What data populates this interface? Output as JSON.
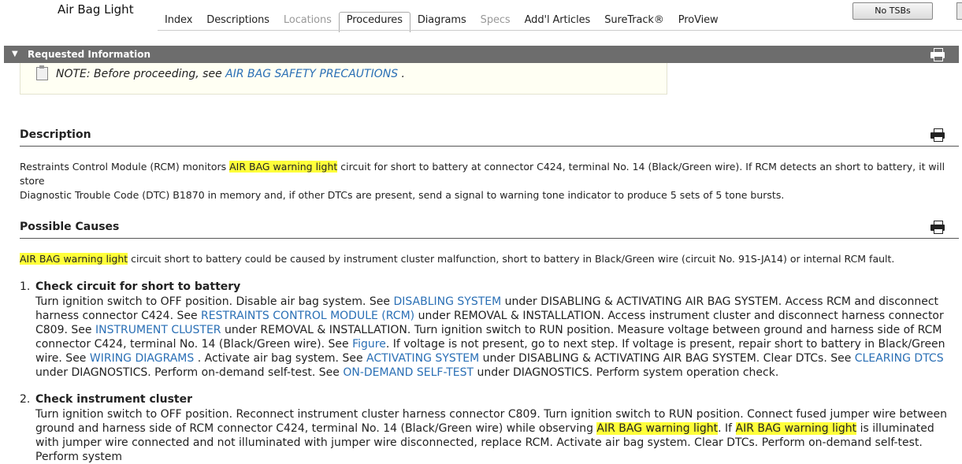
{
  "header": {
    "title": "Air Bag Light",
    "tabs": [
      {
        "label": "Index",
        "state": "normal"
      },
      {
        "label": "Descriptions",
        "state": "normal"
      },
      {
        "label": "Locations",
        "state": "disabled"
      },
      {
        "label": "Procedures",
        "state": "active"
      },
      {
        "label": "Diagrams",
        "state": "normal"
      },
      {
        "label": "Specs",
        "state": "disabled"
      },
      {
        "label": "Add'l Articles",
        "state": "normal"
      },
      {
        "label": "SureTrack®",
        "state": "normal"
      },
      {
        "label": "ProView",
        "state": "normal"
      }
    ],
    "tsb_button": "No TSBs"
  },
  "requested_info": {
    "label": "Requested Information",
    "toggle_icon": "collapse-triangle-icon",
    "print_icon": "printer-icon"
  },
  "note": {
    "prefix": "NOTE: Before proceeding, see ",
    "link": "AIR BAG SAFETY PRECAUTIONS",
    "suffix": " ."
  },
  "description": {
    "heading": "Description",
    "p1_a": "Restraints Control Module (RCM) monitors ",
    "p1_hl": "AIR BAG warning light",
    "p1_b": " circuit for short to battery at connector C424, terminal No. 14 (Black/Green wire). If RCM detects an short to battery, it will store",
    "p2": "Diagnostic Trouble Code (DTC) B1870 in memory and, if other DTCs are present, send a signal to warning tone indicator to produce 5 sets of 5 tone bursts."
  },
  "causes": {
    "heading": "Possible Causes",
    "hl": "AIR BAG warning light",
    "text": " circuit short to battery could be caused by instrument cluster malfunction, short to battery in Black/Green wire (circuit No. 91S-JA14) or internal RCM fault."
  },
  "steps": [
    {
      "num": "1.",
      "title": "Check circuit for short to battery",
      "t1": "Turn ignition switch to OFF position. Disable air bag system. See ",
      "l1": "DISABLING SYSTEM",
      "t2": "  under DISABLING & ACTIVATING AIR BAG SYSTEM. Access RCM and disconnect harness connector C424. See ",
      "l2": "RESTRAINTS CONTROL MODULE (RCM)",
      "t3": "  under REMOVAL & INSTALLATION. Access instrument cluster and disconnect harness connector C809. See ",
      "l3": "INSTRUMENT CLUSTER",
      "t4": "  under REMOVAL & INSTALLATION. Turn ignition switch to RUN position. Measure voltage between ground and harness side of RCM connector C424, terminal No. 14 (Black/Green wire). See ",
      "l4": "Figure",
      "t5": ". If voltage is not present, go to next step. If voltage is present, repair short to battery in Black/Green wire. See ",
      "l5": "WIRING DIAGRAMS",
      "t6": " . Activate air bag system. See ",
      "l6": "ACTIVATING SYSTEM",
      "t7": "  under DISABLING & ACTIVATING AIR BAG SYSTEM. Clear DTCs. See ",
      "l7": "CLEARING DTCS",
      "t8": "  under DIAGNOSTICS. Perform on-demand self-test. See ",
      "l8": "ON-DEMAND SELF-TEST",
      "t9": "  under DIAGNOSTICS. Perform system operation check."
    },
    {
      "num": "2.",
      "title": "Check instrument cluster",
      "t1": "Turn ignition switch to OFF position. Reconnect instrument cluster harness connector C809. Turn ignition switch to RUN position. Connect fused jumper wire between ground and harness side of RCM connector C424, terminal No. 14 (Black/Green wire) while observing ",
      "h1": "AIR BAG warning light",
      "t2": ". If ",
      "h2": "AIR BAG warning light",
      "t3": " is illuminated with jumper wire connected and not illuminated with jumper wire disconnected, replace RCM. Activate air bag system. Clear DTCs. Perform on-demand self-test. Perform system"
    }
  ]
}
